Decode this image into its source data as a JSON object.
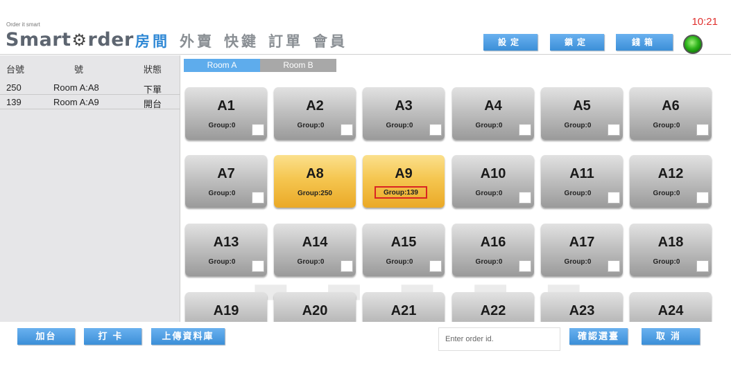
{
  "header": {
    "tagline": "Order it smart",
    "logo_left": "Smart",
    "logo_right": "rder",
    "clock": "10:21",
    "nav": [
      "房間",
      "外賣",
      "快鍵",
      "訂單",
      "會員"
    ],
    "buttons": {
      "settings": "設定",
      "lock": "鎖定",
      "cashbox": "錢箱"
    }
  },
  "list": {
    "columns": [
      "台號",
      "號",
      "狀態"
    ],
    "rows": [
      {
        "table_no": "250",
        "room": "Room A:A8",
        "status": "下單"
      },
      {
        "table_no": "139",
        "room": "Room A:A9",
        "status": "開台"
      }
    ]
  },
  "rooms": {
    "tabs": [
      "Room A",
      "Room B"
    ],
    "active": "Room A"
  },
  "tiles": [
    {
      "name": "A1",
      "group": "Group:0"
    },
    {
      "name": "A2",
      "group": "Group:0"
    },
    {
      "name": "A3",
      "group": "Group:0"
    },
    {
      "name": "A4",
      "group": "Group:0"
    },
    {
      "name": "A5",
      "group": "Group:0"
    },
    {
      "name": "A6",
      "group": "Group:0"
    },
    {
      "name": "A7",
      "group": "Group:0"
    },
    {
      "name": "A8",
      "group": "Group:250"
    },
    {
      "name": "A9",
      "group": "Group:139"
    },
    {
      "name": "A10",
      "group": "Group:0"
    },
    {
      "name": "A11",
      "group": "Group:0"
    },
    {
      "name": "A12",
      "group": "Group:0"
    },
    {
      "name": "A13",
      "group": "Group:0"
    },
    {
      "name": "A14",
      "group": "Group:0"
    },
    {
      "name": "A15",
      "group": "Group:0"
    },
    {
      "name": "A16",
      "group": "Group:0"
    },
    {
      "name": "A17",
      "group": "Group:0"
    },
    {
      "name": "A18",
      "group": "Group:0"
    },
    {
      "name": "A19",
      "group": ""
    },
    {
      "name": "A20",
      "group": ""
    },
    {
      "name": "A21",
      "group": ""
    },
    {
      "name": "A22",
      "group": ""
    },
    {
      "name": "A23",
      "group": ""
    },
    {
      "name": "A24",
      "group": ""
    }
  ],
  "footer": {
    "add_table": "加台",
    "punch": "打卡",
    "upload": "上傳資料庫",
    "order_placeholder": "Enter order id.",
    "confirm": "確認選臺",
    "cancel": "取消"
  },
  "colors": {
    "accent": "#3b8fd8",
    "occupied": "#f5c650",
    "clock": "#e0302e",
    "selected_border": "#d92323"
  }
}
